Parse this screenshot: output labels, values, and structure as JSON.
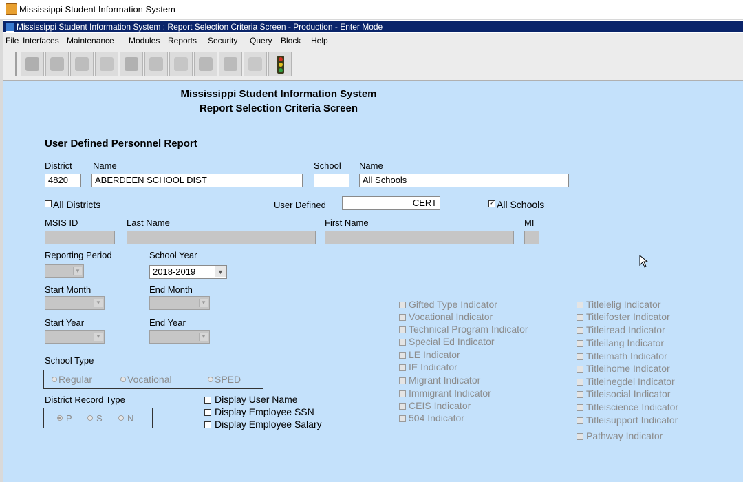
{
  "window": {
    "outer_title": "Mississippi Student Information System",
    "inner_title": "Mississippi Student Information System : Report Selection Criteria Screen  -  Production  -  Enter Mode"
  },
  "menu": [
    "File",
    "Interfaces",
    "Maintenance",
    "Modules",
    "Reports",
    "Security",
    "Query",
    "Block",
    "Help"
  ],
  "toolbar": [
    "save-icon",
    "edit-icon",
    "document-icon",
    "eraser-icon",
    "print-icon",
    "search-icon",
    "add-icon",
    "delete-icon",
    "exit-icon",
    "help-icon",
    "traffic-light-icon"
  ],
  "header": {
    "line1": "Mississippi Student Information System",
    "line2": "Report Selection Criteria Screen"
  },
  "report_title": "User Defined Personnel Report",
  "district": {
    "label": "District",
    "value": "4820"
  },
  "district_name": {
    "label": "Name",
    "value": "ABERDEEN SCHOOL DIST"
  },
  "school": {
    "label": "School",
    "value": ""
  },
  "school_name": {
    "label": "Name",
    "value": "All Schools"
  },
  "all_districts": {
    "label": "All Districts",
    "checked": false
  },
  "user_defined": {
    "label": "User Defined",
    "value": "CERT"
  },
  "all_schools": {
    "label": "All Schools",
    "checked": true
  },
  "person": {
    "msis_id_label": "MSIS ID",
    "last_name_label": "Last Name",
    "first_name_label": "First Name",
    "mi_label": "MI"
  },
  "reporting_period": {
    "label": "Reporting Period",
    "value": ""
  },
  "school_year": {
    "label": "School Year",
    "value": "2018-2019"
  },
  "start_month": {
    "label": "Start Month"
  },
  "end_month": {
    "label": "End Month"
  },
  "start_year": {
    "label": "Start Year"
  },
  "end_year": {
    "label": "End Year"
  },
  "school_type": {
    "label": "School Type",
    "options": [
      "Regular",
      "Vocational",
      "SPED"
    ]
  },
  "district_record_type": {
    "label": "District Record Type",
    "options": [
      "P",
      "S",
      "N"
    ],
    "selected": "P"
  },
  "display_options": [
    "Display User Name",
    "Display Employee SSN",
    "Display Employee Salary"
  ],
  "indicators_col1": [
    "Gifted Type Indicator",
    "Vocational Indicator",
    "Technical Program Indicator",
    "Special Ed Indicator",
    "LE Indicator",
    "IE Indicator",
    "Migrant Indicator",
    "Immigrant Indicator",
    "CEIS Indicator",
    "504 Indicator"
  ],
  "indicators_col2": [
    "Titleielig Indicator",
    "Titleifoster Indicator",
    "Titleiread Indicator",
    "Titleilang Indicator",
    "Titleimath Indicator",
    "Titleihome Indicator",
    "Titleinegdel Indicator",
    "Titleisocial Indicator",
    "Titleiscience Indicator",
    "Titleisupport Indicator",
    "Pathway Indicator"
  ],
  "colors": {
    "canvas": "#c4e1fb",
    "title_bar": "#0a246a",
    "disabled_text": "#8c8c8c"
  }
}
